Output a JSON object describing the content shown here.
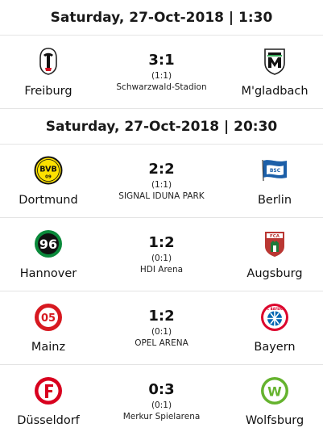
{
  "groups": [
    {
      "date_label": "Saturday, 27-Oct-2018 | 1:30",
      "matches": [
        {
          "home": {
            "name": "Freiburg",
            "crest_icon": "freiburg-crest-icon"
          },
          "away": {
            "name": "M'gladbach",
            "crest_icon": "gladbach-crest-icon"
          },
          "score": "3:1",
          "halftime": "(1:1)",
          "venue": "Schwarzwald-Stadion"
        }
      ]
    },
    {
      "date_label": "Saturday, 27-Oct-2018 | 20:30",
      "matches": [
        {
          "home": {
            "name": "Dortmund",
            "crest_icon": "dortmund-crest-icon"
          },
          "away": {
            "name": "Berlin",
            "crest_icon": "hertha-berlin-crest-icon"
          },
          "score": "2:2",
          "halftime": "(1:1)",
          "venue": "SIGNAL IDUNA PARK"
        },
        {
          "home": {
            "name": "Hannover",
            "crest_icon": "hannover-96-crest-icon"
          },
          "away": {
            "name": "Augsburg",
            "crest_icon": "augsburg-crest-icon"
          },
          "score": "1:2",
          "halftime": "(0:1)",
          "venue": "HDI Arena"
        },
        {
          "home": {
            "name": "Mainz",
            "crest_icon": "mainz-05-crest-icon"
          },
          "away": {
            "name": "Bayern",
            "crest_icon": "bayern-crest-icon"
          },
          "score": "1:2",
          "halftime": "(0:1)",
          "venue": "OPEL ARENA"
        },
        {
          "home": {
            "name": "Düsseldorf",
            "crest_icon": "dusseldorf-crest-icon"
          },
          "away": {
            "name": "Wolfsburg",
            "crest_icon": "wolfsburg-crest-icon"
          },
          "score": "0:3",
          "halftime": "(0:1)",
          "venue": "Merkur Spielarena"
        }
      ]
    }
  ],
  "crest_text": {
    "dortmund": "BVB",
    "dortmund_sub": "09",
    "hannover": "96",
    "augsburg": "FCA",
    "bayern": "FC BAYERN",
    "mainz": "05",
    "hertha": "BSC",
    "wolfsburg": "W"
  },
  "colors": {
    "text": "#111111",
    "divider": "#e4e4e4",
    "dortmund_yellow": "#fde100",
    "hertha_blue": "#1c5fa8",
    "hannover_green": "#0b8a3b",
    "augsburg_red": "#ba3733",
    "mainz_red": "#d71920",
    "bayern_red": "#dc052d",
    "dusseldorf_red": "#d8001e",
    "wolfsburg_green": "#65b32e"
  }
}
